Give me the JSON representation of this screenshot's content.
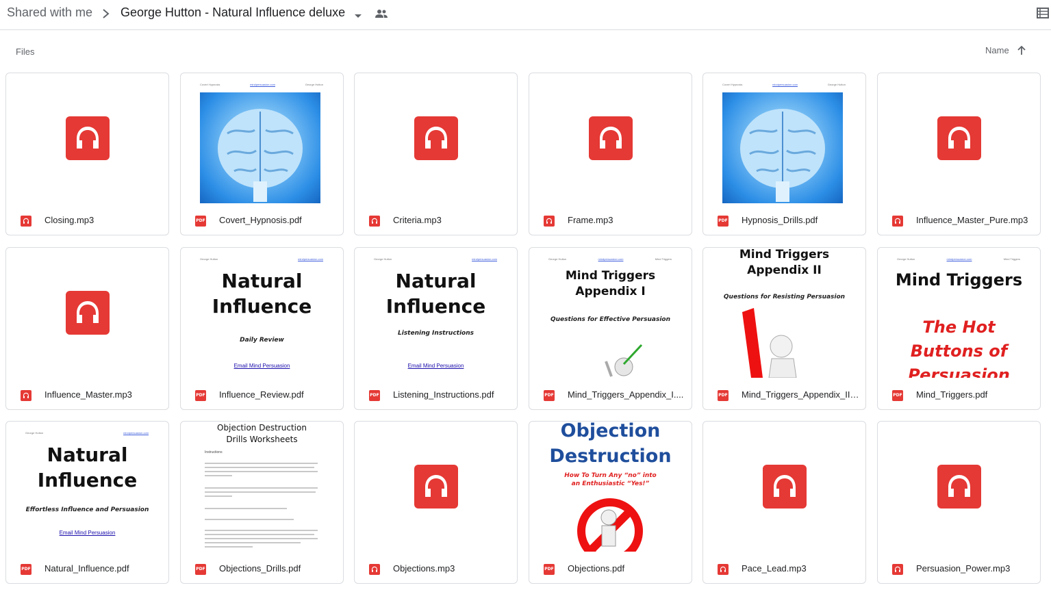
{
  "breadcrumb": {
    "root": "Shared with me",
    "folder": "George Hutton - Natural Influence deluxe"
  },
  "subbar": {
    "section_label": "Files",
    "sort_label": "Name"
  },
  "colors": {
    "audio_red": "#e53935",
    "pdf_red": "#e53935",
    "border": "#dadce0"
  },
  "icons": {
    "pdf_badge": "PDF"
  },
  "files": [
    {
      "name": "Closing.mp3",
      "type": "audio"
    },
    {
      "name": "Covert_Hypnosis.pdf",
      "type": "pdf",
      "preview": {
        "header_left": "Covert Hypnosis",
        "header_mid": "mindpersuasion.com",
        "header_right": "George Hutton"
      }
    },
    {
      "name": "Criteria.mp3",
      "type": "audio"
    },
    {
      "name": "Frame.mp3",
      "type": "audio"
    },
    {
      "name": "Hypnosis_Drills.pdf",
      "type": "pdf",
      "preview": {
        "header_left": "Covert Hypnosis",
        "header_mid": "mindpersuasion.com",
        "header_right": "George Hutton"
      }
    },
    {
      "name": "Influence_Master_Pure.mp3",
      "type": "audio"
    },
    {
      "name": "Influence_Master.mp3",
      "type": "audio"
    },
    {
      "name": "Influence_Review.pdf",
      "type": "pdf",
      "preview": {
        "header_left": "George Hutton",
        "header_mid": "mindpersuasion.com",
        "title1": "Natural",
        "title2": "Influence",
        "subtitle": "Daily Review",
        "link": "Email Mind Persuasion"
      }
    },
    {
      "name": "Listening_Instructions.pdf",
      "type": "pdf",
      "preview": {
        "header_left": "George Hutton",
        "header_mid": "mindpersuasion.com",
        "title1": "Natural",
        "title2": "Influence",
        "subtitle": "Listening Instructions",
        "link": "Email Mind Persuasion"
      }
    },
    {
      "name": "Mind_Triggers_Appendix_I....",
      "type": "pdf",
      "preview": {
        "header_left": "George Hutton",
        "header_mid": "mindpersuasion.com",
        "header_right": "Mind Triggers",
        "title1": "Mind Triggers",
        "title2": "Appendix I",
        "subtitle": "Questions for Effective Persuasion"
      }
    },
    {
      "name": "Mind_Triggers_Appendix_II....",
      "type": "pdf",
      "preview": {
        "title1": "Mind Triggers",
        "title2": "Appendix II",
        "subtitle": "Questions for Resisting Persuasion"
      }
    },
    {
      "name": "Mind_Triggers.pdf",
      "type": "pdf",
      "preview": {
        "header_left": "George Hutton",
        "header_mid": "mindpersuasion.com",
        "header_right": "Mind Triggers",
        "title1": "Mind Triggers",
        "red1": "The Hot",
        "red2": "Buttons of",
        "red3": "Persuasion"
      }
    },
    {
      "name": "Natural_Influence.pdf",
      "type": "pdf",
      "preview": {
        "header_left": "George Hutton",
        "header_mid": "mindpersuasion.com",
        "title1": "Natural",
        "title2": "Influence",
        "subtitle": "Effortless Influence and Persuasion",
        "link": "Email Mind Persuasion"
      }
    },
    {
      "name": "Objections_Drills.pdf",
      "type": "pdf",
      "preview": {
        "title1": "Objection Destruction",
        "title2": "Drills Worksheets",
        "section": "Instructions"
      }
    },
    {
      "name": "Objections.mp3",
      "type": "audio"
    },
    {
      "name": "Objections.pdf",
      "type": "pdf",
      "preview": {
        "title1": "Objection",
        "title2": "Destruction",
        "red1": "How To Turn Any “no” into",
        "red2": "an Enthusiastic “Yes!”"
      }
    },
    {
      "name": "Pace_Lead.mp3",
      "type": "audio"
    },
    {
      "name": "Persuasion_Power.mp3",
      "type": "audio"
    }
  ]
}
